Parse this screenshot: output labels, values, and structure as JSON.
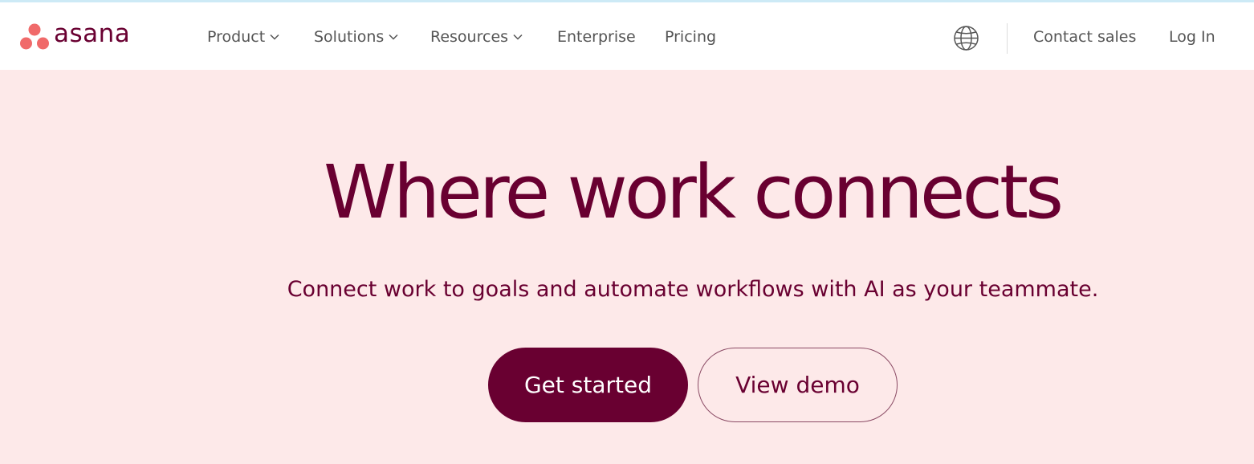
{
  "brand": {
    "name": "asana",
    "dot_color": "#f06a6a",
    "wordmark_color": "#690031"
  },
  "nav": {
    "items": [
      {
        "label": "Product",
        "dropdown": true
      },
      {
        "label": "Solutions",
        "dropdown": true
      },
      {
        "label": "Resources",
        "dropdown": true
      },
      {
        "label": "Enterprise",
        "dropdown": false
      },
      {
        "label": "Pricing",
        "dropdown": false
      }
    ],
    "language_icon": "globe-icon",
    "contact_sales": "Contact sales",
    "log_in": "Log In"
  },
  "hero": {
    "headline": "Where work connects",
    "subheadline": "Connect work to goals and automate workflows with AI as your teammate.",
    "primary_button": "Get started",
    "secondary_button": "View demo",
    "background_color": "#fde9e9",
    "text_color": "#690031"
  }
}
